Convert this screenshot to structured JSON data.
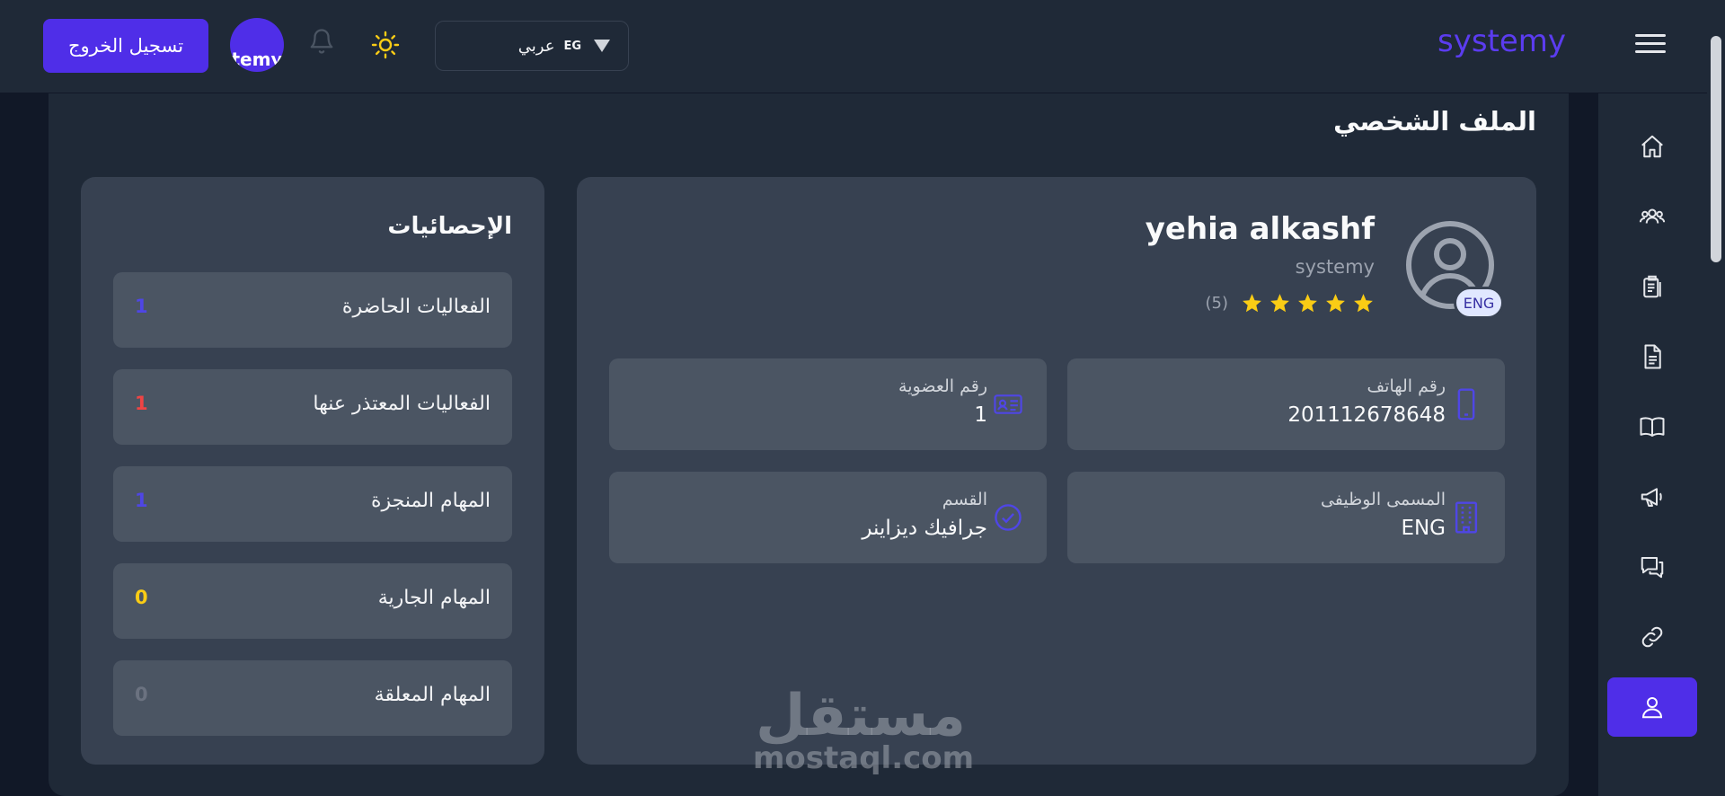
{
  "header": {
    "brand": "systemy",
    "logout_label": "تسجيل الخروج",
    "avatar_text": "temy",
    "language": {
      "flag": "EG",
      "label": "عربي"
    }
  },
  "page": {
    "title": "الملف الشخصي"
  },
  "profile": {
    "name": "yehia alkashf",
    "company": "systemy",
    "badge": "ENG",
    "rating": {
      "stars": 5,
      "count_label": "(5)"
    },
    "info": [
      {
        "label": "رقم الهاتف",
        "value": "201112678648",
        "icon": "phone-icon"
      },
      {
        "label": "رقم العضوية",
        "value": "1",
        "icon": "id-card-icon"
      },
      {
        "label": "المسمى الوظيفى",
        "value": "ENG",
        "icon": "building-icon"
      },
      {
        "label": "القسم",
        "value": "جرافيك ديزاينر",
        "icon": "check-circle-icon"
      }
    ]
  },
  "stats": {
    "title": "الإحصائيات",
    "items": [
      {
        "label": "الفعاليات الحاضرة",
        "value": "1",
        "color": "#4f46e5"
      },
      {
        "label": "الفعاليات المعتذر عنها",
        "value": "1",
        "color": "#ef4444"
      },
      {
        "label": "المهام المنجزة",
        "value": "1",
        "color": "#4f46e5"
      },
      {
        "label": "المهام الجارية",
        "value": "0",
        "color": "#facc15"
      },
      {
        "label": "المهام المعلقة",
        "value": "0",
        "color": "#6b7280"
      }
    ]
  },
  "sidebar": {
    "items": [
      "home-icon",
      "users-icon",
      "clipboard-icon",
      "document-icon",
      "book-icon",
      "megaphone-icon",
      "chat-icon",
      "link-icon",
      "user-icon"
    ],
    "active": "user-icon"
  },
  "watermark": {
    "arabic": "مستقل",
    "latin": "mostaql.com"
  },
  "colors": {
    "accent": "#4f2ee8",
    "star": "#facc15",
    "background": "#111827",
    "panel": "#1f2937"
  }
}
